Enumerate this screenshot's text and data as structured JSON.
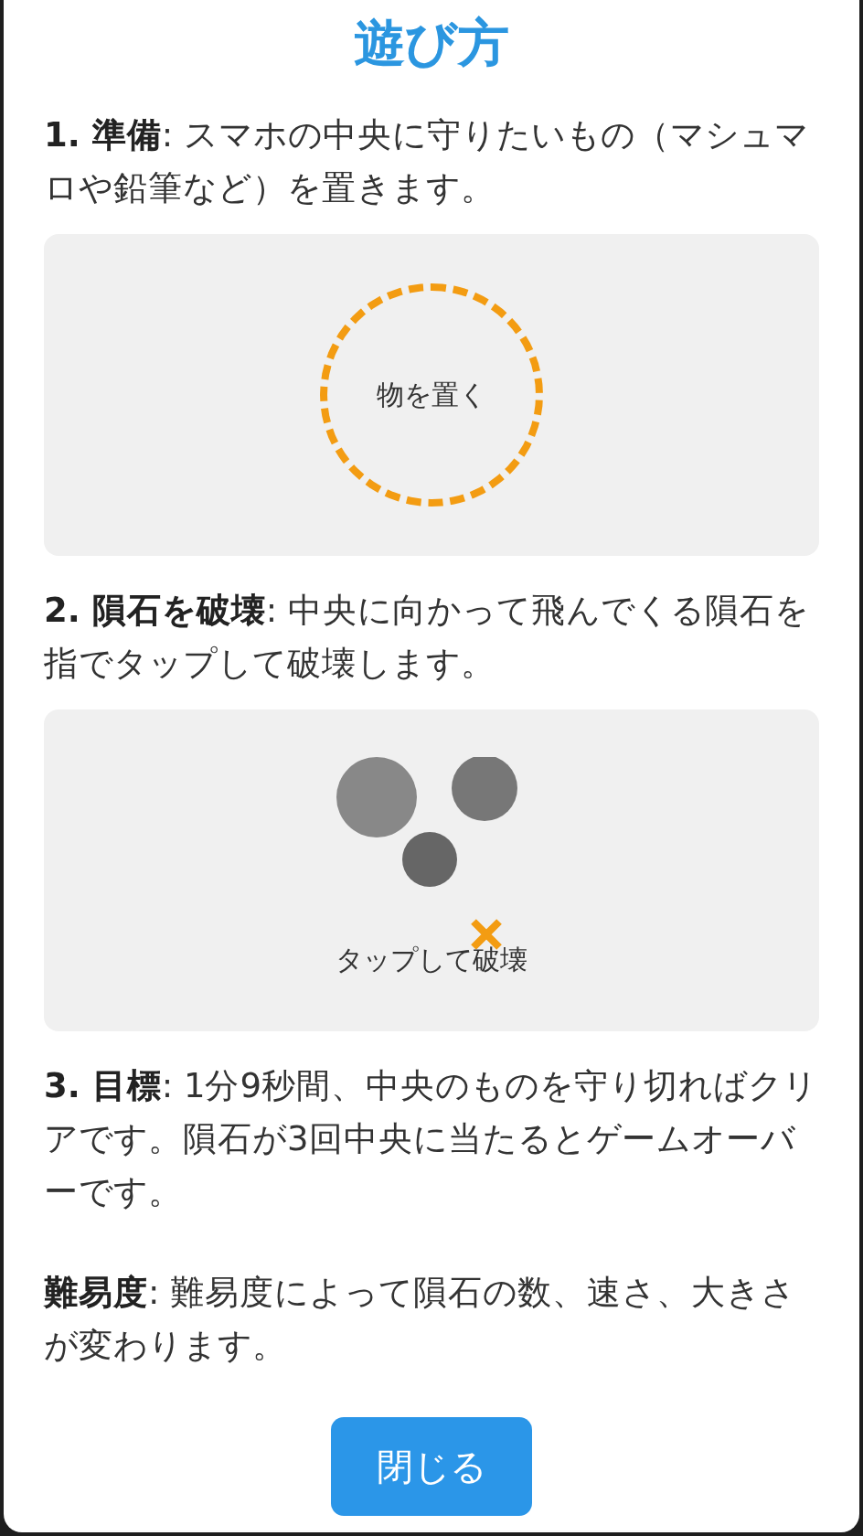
{
  "title": "遊び方",
  "blocks": [
    {
      "kind": "text",
      "text": "**1. 準備**: スマホの中央に守りたいもの（マシュマロや鉛筆など）を置きます。"
    },
    {
      "kind": "place",
      "label": "物を置く"
    },
    {
      "kind": "text",
      "text": "**2. 隕石を破壊**: 中央に向かって飛んでくる隕石を指でタップして破壊します。"
    },
    {
      "kind": "tap",
      "label": "タップして破壊"
    },
    {
      "kind": "text",
      "text": "**3. 目標**: 1分9秒間、中央のものを守り切ればクリアです。隕石が3回中央に当たるとゲームオーバーです。"
    },
    {
      "kind": "text",
      "text": "**難易度**: 難易度によって隕石の数、速さ、大きさが変わります。"
    }
  ],
  "button": "閉じる"
}
